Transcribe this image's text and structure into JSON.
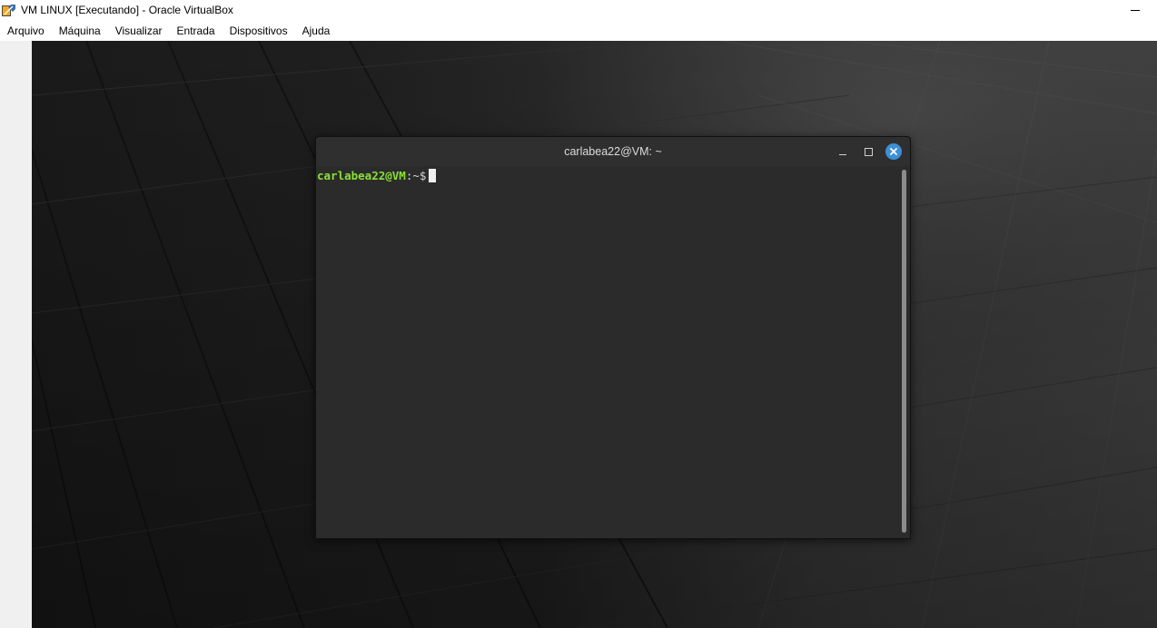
{
  "window": {
    "title": "VM LINUX [Executando] - Oracle VirtualBox",
    "app_icon": "virtualbox-icon"
  },
  "menubar": {
    "items": [
      {
        "label": "Arquivo"
      },
      {
        "label": "Máquina"
      },
      {
        "label": "Visualizar"
      },
      {
        "label": "Entrada"
      },
      {
        "label": "Dispositivos"
      },
      {
        "label": "Ajuda"
      }
    ]
  },
  "guest": {
    "terminal": {
      "title": "carlabea22@VM: ~",
      "prompt": {
        "user_host": "carlabea22@VM",
        "separator": ":",
        "path": "~",
        "symbol": "$"
      },
      "colors": {
        "prompt_user": "#8ae234",
        "close_button": "#3d8fd6",
        "background": "#2b2b2b"
      }
    }
  }
}
